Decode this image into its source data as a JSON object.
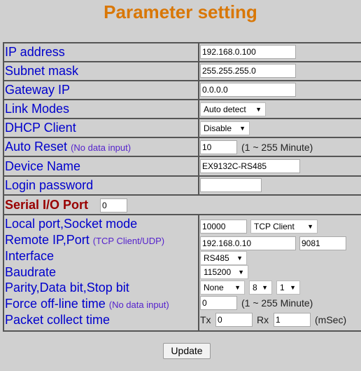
{
  "title": "Parameter setting",
  "network": {
    "ip_label": "IP address",
    "ip_value": "192.168.0.100",
    "subnet_label": "Subnet mask",
    "subnet_value": "255.255.255.0",
    "gateway_label": "Gateway IP",
    "gateway_value": "0.0.0.0",
    "link_label": "Link Modes",
    "link_value": "Auto detect",
    "dhcp_label": "DHCP Client",
    "dhcp_value": "Disable",
    "reset_label": "Auto Reset",
    "reset_note": "(No data input)",
    "reset_value": "10",
    "reset_range": "(1 ~ 255 Minute)",
    "device_label": "Device Name",
    "device_value": "EX9132C-RS485",
    "login_label": "Login password",
    "login_value": ""
  },
  "serial": {
    "label": "Serial I/O Port",
    "port_value": "0",
    "local_label": "Local port,Socket mode",
    "local_port": "10000",
    "socket_mode": "TCP Client",
    "remote_label": "Remote IP,Port",
    "remote_note": "(TCP Client/UDP)",
    "remote_ip": "192.168.0.10",
    "remote_port": "9081",
    "interface_label": "Interface",
    "interface_value": "RS485",
    "baud_label": "Baudrate",
    "baud_value": "115200",
    "parity_label": "Parity,Data bit,Stop bit",
    "parity_value": "None",
    "data_bit": "8",
    "stop_bit": "1",
    "force_label": "Force off-line time",
    "force_note": "(No data input)",
    "force_value": "0",
    "force_range": "(1 ~ 255 Minute)",
    "packet_label": "Packet collect time",
    "tx_label": "Tx",
    "tx_value": "0",
    "rx_label": "Rx",
    "rx_value": "1",
    "unit": "(mSec)"
  },
  "update_label": "Update"
}
